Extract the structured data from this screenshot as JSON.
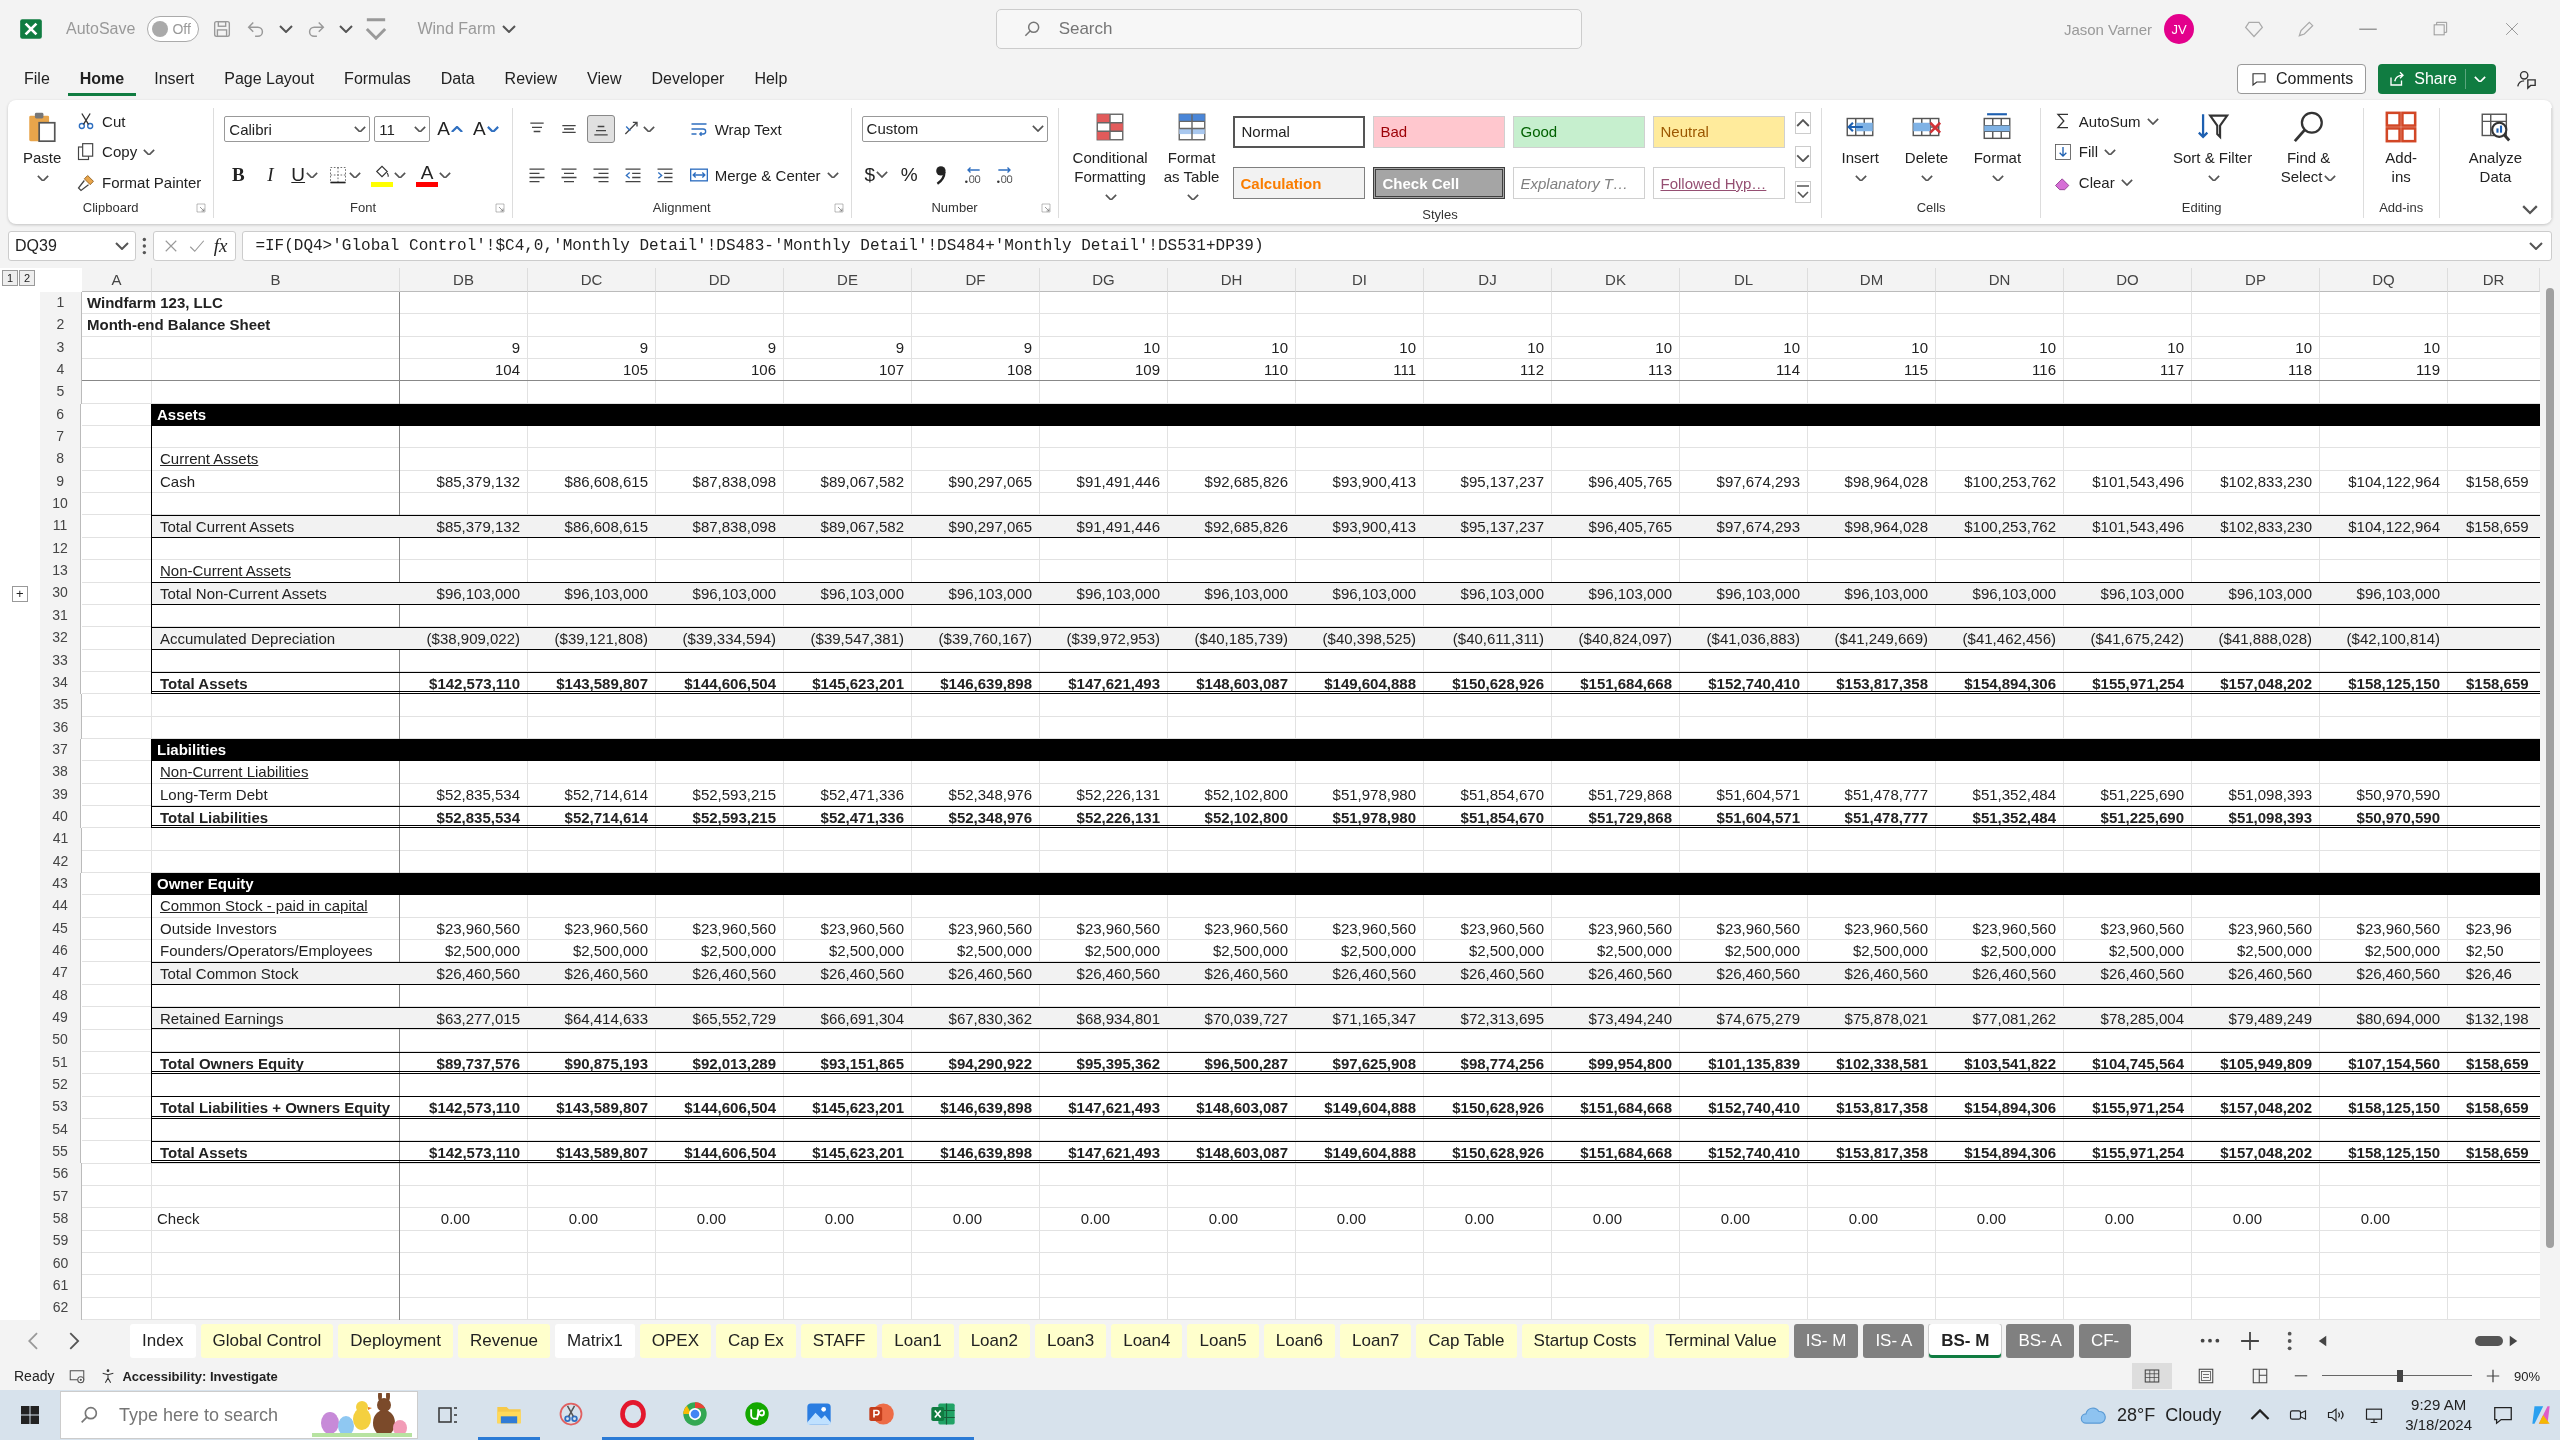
{
  "title_bar": {
    "autosave": {
      "label": "AutoSave",
      "on": false,
      "state_text": "Off"
    },
    "document": "Wind Farm",
    "search": {
      "placeholder": "Search"
    },
    "user": {
      "name": "Jason Varner",
      "initials": "JV"
    }
  },
  "menu": {
    "tabs": [
      {
        "label": "File",
        "selected": false
      },
      {
        "label": "Home",
        "selected": true
      },
      {
        "label": "Insert",
        "selected": false
      },
      {
        "label": "Page Layout",
        "selected": false
      },
      {
        "label": "Formulas",
        "selected": false
      },
      {
        "label": "Data",
        "selected": false
      },
      {
        "label": "Review",
        "selected": false
      },
      {
        "label": "View",
        "selected": false
      },
      {
        "label": "Developer",
        "selected": false
      },
      {
        "label": "Help",
        "selected": false
      }
    ],
    "comments": "Comments",
    "share": "Share"
  },
  "ribbon": {
    "groups": [
      {
        "label": "Clipboard",
        "launcher": true,
        "columns": [
          [
            [
              {
                "kind": "large",
                "text": "Paste",
                "menu": true
              }
            ]
          ],
          [
            [
              {
                "kind": "small",
                "text": "Cut"
              }
            ],
            [
              {
                "kind": "small",
                "text": "Copy",
                "menu": true
              }
            ],
            [
              {
                "kind": "small",
                "text": "Format Painter"
              }
            ]
          ]
        ]
      },
      {
        "label": "Font",
        "launcher": true,
        "columns": [
          [
            [
              {
                "kind": "field",
                "text": "Calibri",
                "menu": true
              },
              {
                "kind": "field",
                "text": "11",
                "menu": true
              },
              {
                "kind": "tool",
                "text": "A"
              },
              {
                "kind": "tool",
                "text": "A"
              }
            ],
            [
              {
                "kind": "bold",
                "text": "B"
              },
              {
                "kind": "italic",
                "text": "I"
              },
              {
                "kind": "underline",
                "text": "U",
                "menu": true
              },
              {
                "kind": "tool",
                "menu": true
              },
              {
                "kind": "swatch",
                "color": "#ffff00",
                "menu": true
              },
              {
                "kind": "swatch",
                "text": "A",
                "color": "#ff0000",
                "menu": true
              }
            ]
          ]
        ]
      },
      {
        "label": "Alignment",
        "launcher": true,
        "columns": [
          [
            [
              {
                "kind": "tool",
                "selected": false
              },
              {
                "kind": "tool",
                "selected": false
              },
              {
                "kind": "tool",
                "selected": true
              },
              {
                "kind": "tool",
                "selected": false,
                "menu": true
              }
            ],
            [
              {
                "kind": "tool"
              },
              {
                "kind": "tool"
              },
              {
                "kind": "tool"
              },
              {
                "kind": "tool"
              },
              {
                "kind": "tool"
              }
            ]
          ],
          [
            [
              {
                "kind": "small",
                "text": "Wrap Text"
              }
            ],
            [
              {
                "kind": "small",
                "text": "Merge & Center",
                "menu": true
              }
            ]
          ]
        ]
      },
      {
        "label": "Number",
        "launcher": true,
        "columns": [
          [
            [
              {
                "kind": "field",
                "text": "Custom",
                "menu": true
              }
            ],
            [
              {
                "kind": "tool",
                "text": "$",
                "menu": true
              },
              {
                "kind": "tool",
                "text": "%"
              },
              {
                "kind": "tool"
              },
              {
                "kind": "tool"
              },
              {
                "kind": "tool"
              }
            ]
          ]
        ]
      },
      {
        "label": "Styles",
        "columns": [
          [
            [
              {
                "kind": "large",
                "text": "Conditional Formatting",
                "menu": true
              }
            ]
          ],
          [
            [
              {
                "kind": "large",
                "text": "Format as Table",
                "menu": true
              }
            ]
          ],
          [
            [
              {
                "kind": "style",
                "text": "Normal",
                "selected": true
              },
              {
                "kind": "style",
                "text": "Bad",
                "selected": false
              },
              {
                "kind": "style",
                "text": "Good",
                "selected": false
              },
              {
                "kind": "style",
                "text": "Neutral",
                "selected": false
              }
            ],
            [
              {
                "kind": "style",
                "text": "Calculation",
                "selected": false
              },
              {
                "kind": "style",
                "text": "Check Cell",
                "selected": false
              },
              {
                "kind": "style",
                "text": "Explanatory T…",
                "selected": false
              },
              {
                "kind": "style",
                "text": "Followed Hyp…",
                "selected": false
              }
            ]
          ],
          [
            [
              {
                "kind": "scroll"
              }
            ],
            [
              {
                "kind": "scroll"
              }
            ],
            [
              {
                "kind": "scroll"
              }
            ]
          ]
        ]
      },
      {
        "label": "Cells",
        "columns": [
          [
            [
              {
                "kind": "large",
                "text": "Insert",
                "menu": true
              }
            ]
          ],
          [
            [
              {
                "kind": "large",
                "text": "Delete",
                "menu": true
              }
            ]
          ],
          [
            [
              {
                "kind": "large",
                "text": "Format",
                "menu": true
              }
            ]
          ]
        ]
      },
      {
        "label": "Editing",
        "columns": [
          [
            [
              {
                "kind": "small",
                "text": "AutoSum",
                "menu": true
              }
            ],
            [
              {
                "kind": "small",
                "text": "Fill",
                "menu": true
              }
            ],
            [
              {
                "kind": "small",
                "text": "Clear",
                "menu": true
              }
            ]
          ],
          [
            [
              {
                "kind": "large",
                "text": "Sort & Filter",
                "menu": true
              }
            ]
          ],
          [
            [
              {
                "kind": "large",
                "text": "Find & Select",
                "menu": true
              }
            ]
          ]
        ]
      },
      {
        "label": "Add-ins",
        "columns": [
          [
            [
              {
                "kind": "large",
                "text": "Add-ins"
              }
            ]
          ]
        ]
      },
      {
        "columns": [
          [
            [
              {
                "kind": "large",
                "text": "Analyze Data"
              }
            ]
          ]
        ]
      }
    ]
  },
  "formula_bar": {
    "name_box": "DQ39",
    "fx": "fx",
    "formula": "=IF(DQ4>'Global Control'!$C4,0,'Monthly Detail'!DS483-'Monthly Detail'!DS484+'Monthly Detail'!DS531+DP39)"
  },
  "sheet": {
    "outline_levels": [
      "1",
      "2"
    ],
    "columns": [
      "A",
      "B",
      "DB",
      "DC",
      "DD",
      "DE",
      "DF",
      "DG",
      "DH",
      "DI",
      "DJ",
      "DK",
      "DL",
      "DM",
      "DN",
      "DO",
      "DP",
      "DQ",
      "DR"
    ],
    "rows": [
      {
        "num": "1",
        "kind": "title",
        "label": "Windfarm 123, LLC"
      },
      {
        "num": "2",
        "kind": "title",
        "label": "Month-end Balance Sheet"
      },
      {
        "num": "3",
        "kind": "period",
        "cells": [
          "9",
          "9",
          "9",
          "9",
          "9",
          "10",
          "10",
          "10",
          "10",
          "10",
          "10",
          "10",
          "10",
          "10",
          "10",
          "10"
        ]
      },
      {
        "num": "4",
        "kind": "period",
        "cells": [
          "104",
          "105",
          "106",
          "107",
          "108",
          "109",
          "110",
          "111",
          "112",
          "113",
          "114",
          "115",
          "116",
          "117",
          "118",
          "119"
        ]
      },
      {
        "num": "5",
        "kind": "blank"
      },
      {
        "num": "6",
        "kind": "header",
        "label": "Assets"
      },
      {
        "num": "7",
        "kind": "gap"
      },
      {
        "num": "8",
        "kind": "subhead",
        "label": "Current Assets"
      },
      {
        "num": "9",
        "kind": "item",
        "label": "Cash",
        "cells": [
          "$85,379,132",
          "$86,608,615",
          "$87,838,098",
          "$89,067,582",
          "$90,297,065",
          "$91,491,446",
          "$92,685,826",
          "$93,900,413",
          "$95,137,237",
          "$96,405,765",
          "$97,674,293",
          "$98,964,028",
          "$100,253,762",
          "$101,543,496",
          "$102,833,230",
          "$104,122,964"
        ],
        "cut": "$158,659"
      },
      {
        "num": "10",
        "kind": "gap"
      },
      {
        "num": "11",
        "kind": "total",
        "label": "Total Current Assets",
        "cells": [
          "$85,379,132",
          "$86,608,615",
          "$87,838,098",
          "$89,067,582",
          "$90,297,065",
          "$91,491,446",
          "$92,685,826",
          "$93,900,413",
          "$95,137,237",
          "$96,405,765",
          "$97,674,293",
          "$98,964,028",
          "$100,253,762",
          "$101,543,496",
          "$102,833,230",
          "$104,122,964"
        ],
        "cut": "$158,659"
      },
      {
        "num": "12",
        "kind": "gap"
      },
      {
        "num": "13",
        "kind": "subhead",
        "label": "Non-Current Assets"
      },
      {
        "num": "30",
        "kind": "total",
        "outline": "+",
        "label": "Total Non-Current Assets",
        "cells": [
          "$96,103,000",
          "$96,103,000",
          "$96,103,000",
          "$96,103,000",
          "$96,103,000",
          "$96,103,000",
          "$96,103,000",
          "$96,103,000",
          "$96,103,000",
          "$96,103,000",
          "$96,103,000",
          "$96,103,000",
          "$96,103,000",
          "$96,103,000",
          "$96,103,000",
          "$96,103,000"
        ]
      },
      {
        "num": "31",
        "kind": "gap"
      },
      {
        "num": "32",
        "kind": "total",
        "label": "Accumulated Depreciation",
        "cells": [
          "($38,909,022)",
          "($39,121,808)",
          "($39,334,594)",
          "($39,547,381)",
          "($39,760,167)",
          "($39,972,953)",
          "($40,185,739)",
          "($40,398,525)",
          "($40,611,311)",
          "($40,824,097)",
          "($41,036,883)",
          "($41,249,669)",
          "($41,462,456)",
          "($41,675,242)",
          "($41,888,028)",
          "($42,100,814)"
        ]
      },
      {
        "num": "33",
        "kind": "gap"
      },
      {
        "num": "34",
        "kind": "grand",
        "label": "Total Assets",
        "cells": [
          "$142,573,110",
          "$143,589,807",
          "$144,606,504",
          "$145,623,201",
          "$146,639,898",
          "$147,621,493",
          "$148,603,087",
          "$149,604,888",
          "$150,628,926",
          "$151,684,668",
          "$152,740,410",
          "$153,817,358",
          "$154,894,306",
          "$155,971,254",
          "$157,048,202",
          "$158,125,150"
        ],
        "cut": "$158,659"
      },
      {
        "num": "35",
        "kind": "blank"
      },
      {
        "num": "36",
        "kind": "blank"
      },
      {
        "num": "37",
        "kind": "header",
        "label": "Liabilities"
      },
      {
        "num": "38",
        "kind": "subhead",
        "label": "Non-Current Liabilities"
      },
      {
        "num": "39",
        "kind": "item",
        "label": "Long-Term Debt",
        "cells": [
          "$52,835,534",
          "$52,714,614",
          "$52,593,215",
          "$52,471,336",
          "$52,348,976",
          "$52,226,131",
          "$52,102,800",
          "$51,978,980",
          "$51,854,670",
          "$51,729,868",
          "$51,604,571",
          "$51,478,777",
          "$51,352,484",
          "$51,225,690",
          "$51,098,393",
          "$50,970,590"
        ]
      },
      {
        "num": "40",
        "kind": "grand",
        "label": "Total Liabilities",
        "cells": [
          "$52,835,534",
          "$52,714,614",
          "$52,593,215",
          "$52,471,336",
          "$52,348,976",
          "$52,226,131",
          "$52,102,800",
          "$51,978,980",
          "$51,854,670",
          "$51,729,868",
          "$51,604,571",
          "$51,478,777",
          "$51,352,484",
          "$51,225,690",
          "$51,098,393",
          "$50,970,590"
        ]
      },
      {
        "num": "41",
        "kind": "blank"
      },
      {
        "num": "42",
        "kind": "blank"
      },
      {
        "num": "43",
        "kind": "header",
        "label": "Owner Equity"
      },
      {
        "num": "44",
        "kind": "subhead",
        "label": "Common Stock - paid in capital"
      },
      {
        "num": "45",
        "kind": "item",
        "label": "Outside Investors",
        "cells": [
          "$23,960,560",
          "$23,960,560",
          "$23,960,560",
          "$23,960,560",
          "$23,960,560",
          "$23,960,560",
          "$23,960,560",
          "$23,960,560",
          "$23,960,560",
          "$23,960,560",
          "$23,960,560",
          "$23,960,560",
          "$23,960,560",
          "$23,960,560",
          "$23,960,560",
          "$23,960,560"
        ],
        "cut": "$23,96"
      },
      {
        "num": "46",
        "kind": "item",
        "label": "Founders/Operators/Employees",
        "cells": [
          "$2,500,000",
          "$2,500,000",
          "$2,500,000",
          "$2,500,000",
          "$2,500,000",
          "$2,500,000",
          "$2,500,000",
          "$2,500,000",
          "$2,500,000",
          "$2,500,000",
          "$2,500,000",
          "$2,500,000",
          "$2,500,000",
          "$2,500,000",
          "$2,500,000",
          "$2,500,000"
        ],
        "cut": "$2,50"
      },
      {
        "num": "47",
        "kind": "total",
        "label": "Total Common Stock",
        "cells": [
          "$26,460,560",
          "$26,460,560",
          "$26,460,560",
          "$26,460,560",
          "$26,460,560",
          "$26,460,560",
          "$26,460,560",
          "$26,460,560",
          "$26,460,560",
          "$26,460,560",
          "$26,460,560",
          "$26,460,560",
          "$26,460,560",
          "$26,460,560",
          "$26,460,560",
          "$26,460,560"
        ],
        "cut": "$26,46"
      },
      {
        "num": "48",
        "kind": "gap"
      },
      {
        "num": "49",
        "kind": "total",
        "label": "Retained Earnings",
        "cells": [
          "$63,277,015",
          "$64,414,633",
          "$65,552,729",
          "$66,691,304",
          "$67,830,362",
          "$68,934,801",
          "$70,039,727",
          "$71,165,347",
          "$72,313,695",
          "$73,494,240",
          "$74,675,279",
          "$75,878,021",
          "$77,081,262",
          "$78,285,004",
          "$79,489,249",
          "$80,694,000"
        ],
        "cut": "$132,198"
      },
      {
        "num": "50",
        "kind": "gap"
      },
      {
        "num": "51",
        "kind": "grand",
        "label": "Total Owners Equity",
        "cells": [
          "$89,737,576",
          "$90,875,193",
          "$92,013,289",
          "$93,151,865",
          "$94,290,922",
          "$95,395,362",
          "$96,500,287",
          "$97,625,908",
          "$98,774,256",
          "$99,954,800",
          "$101,135,839",
          "$102,338,581",
          "$103,541,822",
          "$104,745,564",
          "$105,949,809",
          "$107,154,560"
        ],
        "cut": "$158,659"
      },
      {
        "num": "52",
        "kind": "gap"
      },
      {
        "num": "53",
        "kind": "grand",
        "label": "Total Liabilities + Owners Equity",
        "cells": [
          "$142,573,110",
          "$143,589,807",
          "$144,606,504",
          "$145,623,201",
          "$146,639,898",
          "$147,621,493",
          "$148,603,087",
          "$149,604,888",
          "$150,628,926",
          "$151,684,668",
          "$152,740,410",
          "$153,817,358",
          "$154,894,306",
          "$155,971,254",
          "$157,048,202",
          "$158,125,150"
        ],
        "cut": "$158,659"
      },
      {
        "num": "54",
        "kind": "gap"
      },
      {
        "num": "55",
        "kind": "grand",
        "label": "Total Assets",
        "cells": [
          "$142,573,110",
          "$143,589,807",
          "$144,606,504",
          "$145,623,201",
          "$146,639,898",
          "$147,621,493",
          "$148,603,087",
          "$149,604,888",
          "$150,628,926",
          "$151,684,668",
          "$152,740,410",
          "$153,817,358",
          "$154,894,306",
          "$155,971,254",
          "$157,048,202",
          "$158,125,150"
        ],
        "cut": "$158,659"
      },
      {
        "num": "56",
        "kind": "blank"
      },
      {
        "num": "57",
        "kind": "blank"
      },
      {
        "num": "58",
        "kind": "check",
        "label": "Check",
        "cells": [
          "0.00",
          "0.00",
          "0.00",
          "0.00",
          "0.00",
          "0.00",
          "0.00",
          "0.00",
          "0.00",
          "0.00",
          "0.00",
          "0.00",
          "0.00",
          "0.00",
          "0.00",
          "0.00"
        ]
      },
      {
        "num": "59",
        "kind": "blank"
      },
      {
        "num": "60",
        "kind": "blank"
      },
      {
        "num": "61",
        "kind": "blank"
      },
      {
        "num": "62",
        "kind": "blank"
      }
    ]
  },
  "sheet_tabs": [
    {
      "label": "Index",
      "color": "#ffffff",
      "selected": false
    },
    {
      "label": "Global Control",
      "color": "#ffffcc",
      "selected": false
    },
    {
      "label": "Deployment",
      "color": "#ffffcc",
      "selected": false
    },
    {
      "label": "Revenue",
      "color": "#ffffcc",
      "selected": false
    },
    {
      "label": "Matrix1",
      "color": "#ffffff",
      "selected": false
    },
    {
      "label": "OPEX",
      "color": "#ffffcc",
      "selected": false
    },
    {
      "label": "Cap Ex",
      "color": "#ffffcc",
      "selected": false
    },
    {
      "label": "STAFF",
      "color": "#ffffcc",
      "selected": false
    },
    {
      "label": "Loan1",
      "color": "#ffffcc",
      "selected": false
    },
    {
      "label": "Loan2",
      "color": "#ffffcc",
      "selected": false
    },
    {
      "label": "Loan3",
      "color": "#ffffcc",
      "selected": false
    },
    {
      "label": "Loan4",
      "color": "#ffffcc",
      "selected": false
    },
    {
      "label": "Loan5",
      "color": "#ffffcc",
      "selected": false
    },
    {
      "label": "Loan6",
      "color": "#ffffcc",
      "selected": false
    },
    {
      "label": "Loan7",
      "color": "#ffffcc",
      "selected": false
    },
    {
      "label": "Cap Table",
      "color": "#ffffcc",
      "selected": false
    },
    {
      "label": "Startup Costs",
      "color": "#ffffcc",
      "selected": false
    },
    {
      "label": "Terminal Value",
      "color": "#ffffcc",
      "selected": false
    },
    {
      "label": "IS- M",
      "color": "#808080",
      "selected": false
    },
    {
      "label": "IS- A",
      "color": "#808080",
      "selected": false
    },
    {
      "label": "BS- M",
      "color": "#ffffff",
      "selected": true
    },
    {
      "label": "BS- A",
      "color": "#808080",
      "selected": false
    },
    {
      "label": "CF-",
      "color": "#808080",
      "selected": false
    }
  ],
  "status_bar": {
    "mode": "Ready",
    "accessibility": "Accessibility: Investigate",
    "views": [
      {
        "selected": true
      },
      {
        "selected": false
      },
      {
        "selected": false
      }
    ],
    "zoom": {
      "level": 0.52,
      "reading": "90%"
    }
  },
  "taskbar": {
    "search": {
      "placeholder": "Type here to search"
    },
    "apps": [
      {
        "running": true
      },
      {
        "running": false
      },
      {
        "running": true
      },
      {
        "running": true
      },
      {
        "running": true
      },
      {
        "running": true
      },
      {
        "running": true
      },
      {
        "running": true
      }
    ],
    "weather": {
      "temperature": "28°F",
      "condition": "Cloudy"
    },
    "time": "9:29 AM",
    "date": "3/18/2024"
  }
}
